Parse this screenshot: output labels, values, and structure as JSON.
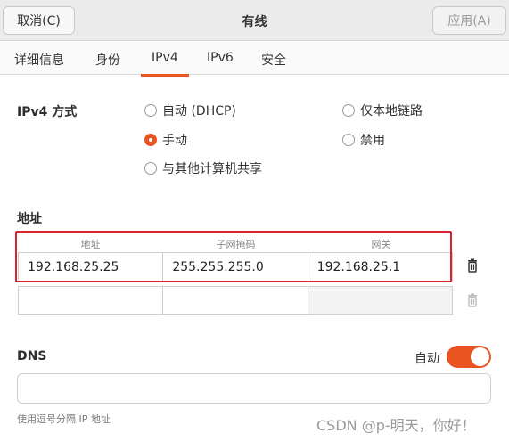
{
  "header": {
    "cancel_label": "取消(C)",
    "title": "有线",
    "apply_label": "应用(A)"
  },
  "tabs": [
    {
      "label": "详细信息",
      "active": false
    },
    {
      "label": "身份",
      "active": false
    },
    {
      "label": "IPv4",
      "active": true
    },
    {
      "label": "IPv6",
      "active": false
    },
    {
      "label": "安全",
      "active": false
    }
  ],
  "ipv4_method": {
    "label": "IPv4 方式",
    "options": [
      {
        "label": "自动 (DHCP)",
        "selected": false
      },
      {
        "label": "仅本地链路",
        "selected": false
      },
      {
        "label": "手动",
        "selected": true
      },
      {
        "label": "禁用",
        "selected": false
      },
      {
        "label": "与其他计算机共享",
        "selected": false
      }
    ]
  },
  "addresses": {
    "section_label": "地址",
    "columns": [
      "地址",
      "子网掩码",
      "网关"
    ],
    "rows": [
      {
        "address": "192.168.25.25",
        "netmask": "255.255.255.0",
        "gateway": "192.168.25.1"
      },
      {
        "address": "",
        "netmask": "",
        "gateway": ""
      }
    ]
  },
  "dns": {
    "label": "DNS",
    "auto_label": "自动",
    "auto_on": true,
    "value": "",
    "hint": "使用逗号分隔 IP 地址"
  },
  "watermark": "CSDN @p-明天，你好！",
  "colors": {
    "accent": "#e95420",
    "highlight_border": "#d9232f"
  }
}
